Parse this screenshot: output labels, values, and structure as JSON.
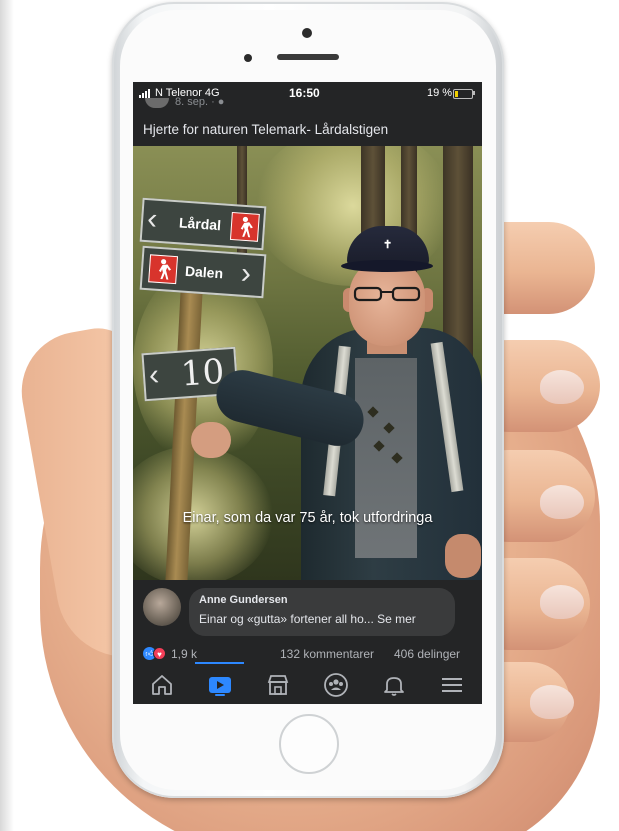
{
  "status_bar": {
    "carrier": "N Telenor  4G",
    "time": "16:50",
    "battery": "19 %",
    "battery_level": 0.19
  },
  "post": {
    "date": "8. sep. · ●",
    "title": "Hjerte for naturen Telemark- Lårdalstigen",
    "video": {
      "caption": "Einar, som da var 75 år, tok utfordringa",
      "signs": {
        "sign1": "Lårdal",
        "sign2": "Dalen",
        "sign3": "10"
      },
      "progress": 0.14
    }
  },
  "comment": {
    "author": "Anne Gundersen",
    "text": "Einar og «gutta» fortener all ho... Se mer"
  },
  "reactions": {
    "count": "1,9 k",
    "comments": "132 kommentarer",
    "shares": "406 delinger"
  },
  "nav": {
    "items": [
      {
        "icon": "home-icon",
        "active": false
      },
      {
        "icon": "watch-icon",
        "active": true
      },
      {
        "icon": "marketplace-icon",
        "active": false
      },
      {
        "icon": "groups-icon",
        "active": false
      },
      {
        "icon": "notifications-icon",
        "active": false
      },
      {
        "icon": "menu-icon",
        "active": false
      }
    ]
  },
  "colors": {
    "accent": "#2d88ff",
    "love": "#f33e58",
    "screen_bg": "#242526",
    "comment_bubble": "#3a3b3c"
  }
}
